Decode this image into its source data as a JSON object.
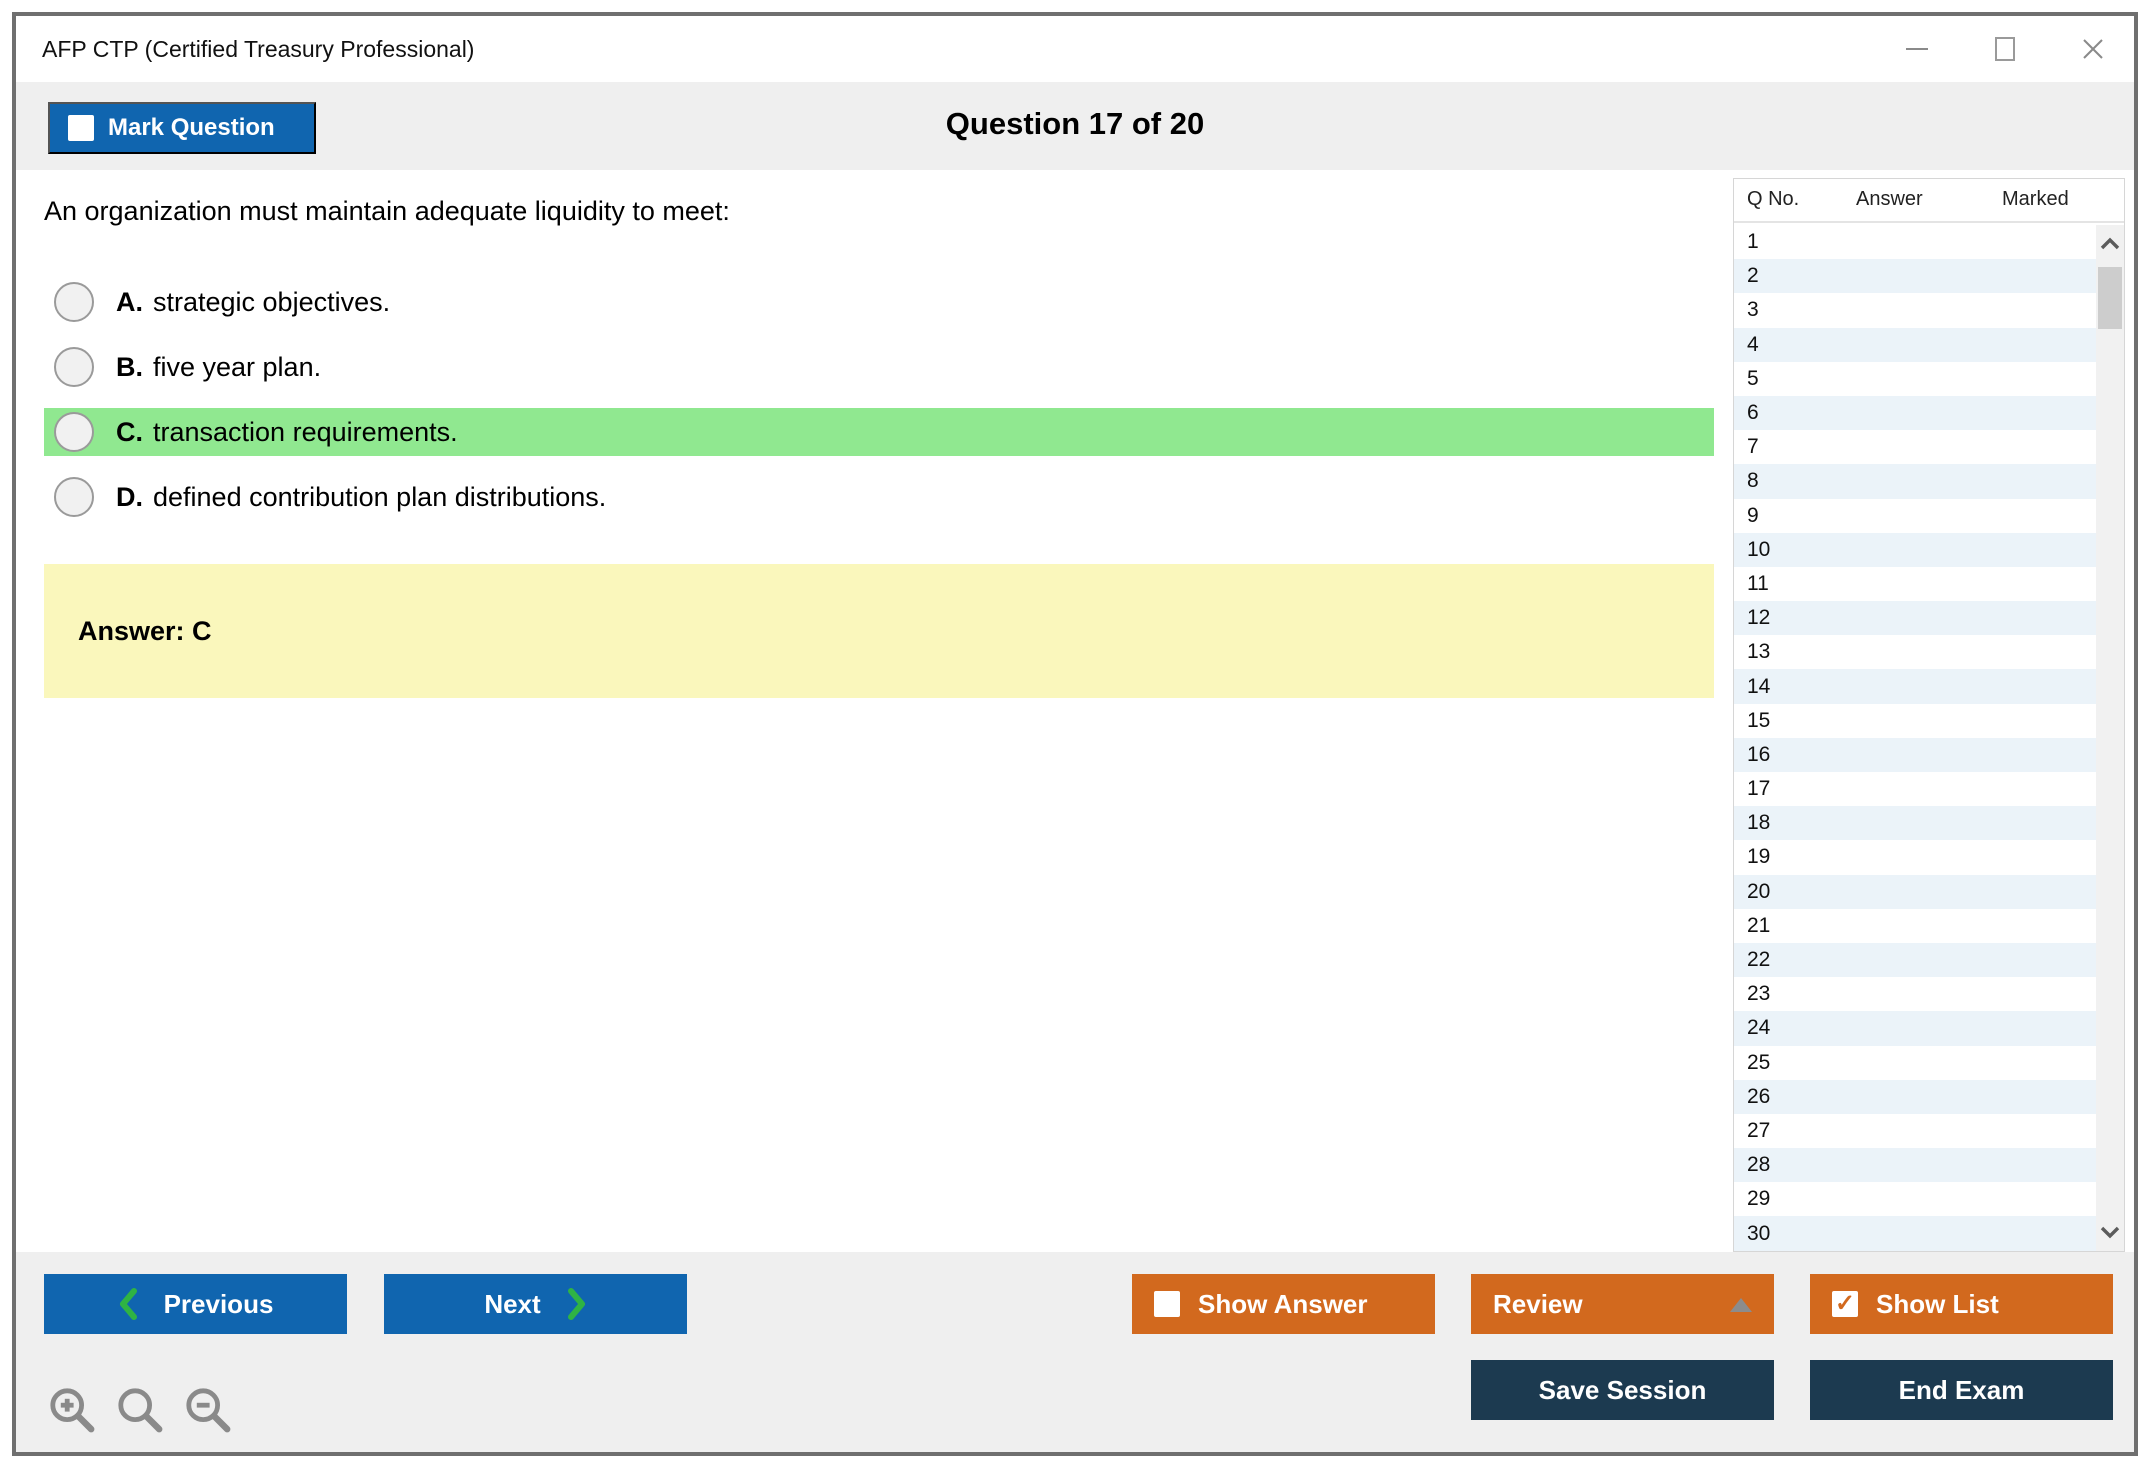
{
  "window": {
    "title": "AFP CTP (Certified Treasury Professional)"
  },
  "header": {
    "mark_question_label": "Mark Question",
    "question_counter": "Question 17 of 20"
  },
  "question": {
    "text": "An organization must maintain adequate liquidity to meet:",
    "options": [
      {
        "letter": "A.",
        "text": "strategic objectives.",
        "highlighted": false
      },
      {
        "letter": "B.",
        "text": "five year plan.",
        "highlighted": false
      },
      {
        "letter": "C.",
        "text": "transaction requirements.",
        "highlighted": true
      },
      {
        "letter": "D.",
        "text": "defined contribution plan distributions.",
        "highlighted": false
      }
    ],
    "answer_label": "Answer: C"
  },
  "sidebar": {
    "columns": [
      "Q No.",
      "Answer",
      "Marked"
    ],
    "rows": [
      "1",
      "2",
      "3",
      "4",
      "5",
      "6",
      "7",
      "8",
      "9",
      "10",
      "11",
      "12",
      "13",
      "14",
      "15",
      "16",
      "17",
      "18",
      "19",
      "20",
      "21",
      "22",
      "23",
      "24",
      "25",
      "26",
      "27",
      "28",
      "29",
      "30"
    ]
  },
  "footer": {
    "previous_label": "Previous",
    "next_label": "Next",
    "show_answer_label": "Show Answer",
    "review_label": "Review",
    "show_list_label": "Show List",
    "save_session_label": "Save Session",
    "end_exam_label": "End Exam"
  },
  "icons": {
    "show_list_check": "✓",
    "minimize": "minus-line",
    "maximize": "square-outline",
    "close": "thin-x",
    "previous_chevron": "chevron-left-green",
    "next_chevron": "chevron-right-green",
    "review_caret": "triangle-up-gray",
    "zoom_tools": [
      "zoom-in",
      "zoom",
      "zoom-out"
    ]
  },
  "colors": {
    "accent_blue": "#1065af",
    "accent_orange": "#d2691e",
    "navy": "#1c3a50",
    "highlight_green": "#90e890",
    "answer_yellow": "#faf7bc",
    "row_alt_blue": "#ebf3f9",
    "chrome_gray": "#efefef"
  }
}
